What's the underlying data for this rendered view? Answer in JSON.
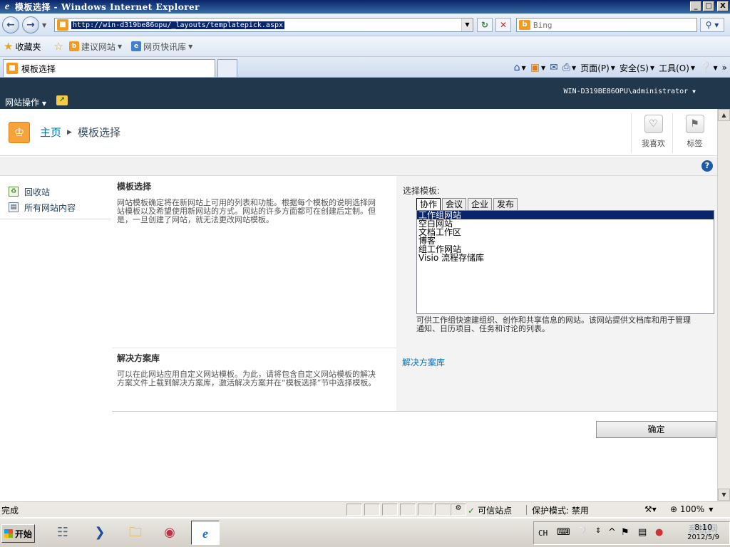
{
  "window": {
    "title": "模板选择 - Windows Internet Explorer",
    "buttons": [
      "_",
      "□",
      "X"
    ]
  },
  "address_bar": {
    "url": "http://win-d319be86opu/_layouts/templatepick.aspx",
    "search_placeholder": "Bing"
  },
  "favorites_bar": {
    "favorites_label": "收藏夹",
    "suggested_sites": "建议网站",
    "web_slices": "网页快讯库"
  },
  "tab": {
    "title": "模板选择"
  },
  "command_bar": {
    "page": "页面(P)",
    "safety": "安全(S)",
    "tools": "工具(O)"
  },
  "sharepoint": {
    "user": "WIN-D319BE86OPU\\administrator",
    "site_actions": "网站操作",
    "breadcrumb_home": "主页",
    "breadcrumb_current": "模板选择",
    "like_label": "我喜欢",
    "tags_label": "标签"
  },
  "left_nav": [
    {
      "label": "回收站",
      "icon": "recycle-bin-icon"
    },
    {
      "label": "所有网站内容",
      "icon": "site-content-icon"
    }
  ],
  "template_section": {
    "heading": "模板选择",
    "description": "网站模板确定将在新网站上可用的列表和功能。根据每个模板的说明选择网站模板以及希望使用新网站的方式。网站的许多方面都可在创建后定制。但是，一旦创建了网站，就无法更改网站模板。",
    "select_label": "选择模板:",
    "tabs": [
      "协作",
      "会议",
      "企业",
      "发布"
    ],
    "active_tab": "协作",
    "templates": [
      "工作组网站",
      "空白网站",
      "文档工作区",
      "博客",
      "组工作网站",
      "Visio 流程存储库"
    ],
    "selected_template": "工作组网站",
    "template_description": "可供工作组快速建组织、创作和共享信息的网站。该网站提供文档库和用于管理通知、日历项目、任务和讨论的列表。"
  },
  "solution_section": {
    "heading": "解决方案库",
    "description": "可以在此网站应用自定义网站模板。为此，请将包含自定义网站模板的解决方案文件上载到解决方案库，激活解决方案并在“模板选择”节中选择模板。",
    "link": "解决方案库"
  },
  "ok_button": "确定",
  "status_bar": {
    "status": "完成",
    "zone": "可信站点",
    "protected_mode": "保护模式: 禁用",
    "zoom": "100%"
  },
  "taskbar": {
    "start": "开始",
    "lang": "CH",
    "time": "8:10",
    "date": "2012/5/9",
    "watermark": "系统网"
  }
}
